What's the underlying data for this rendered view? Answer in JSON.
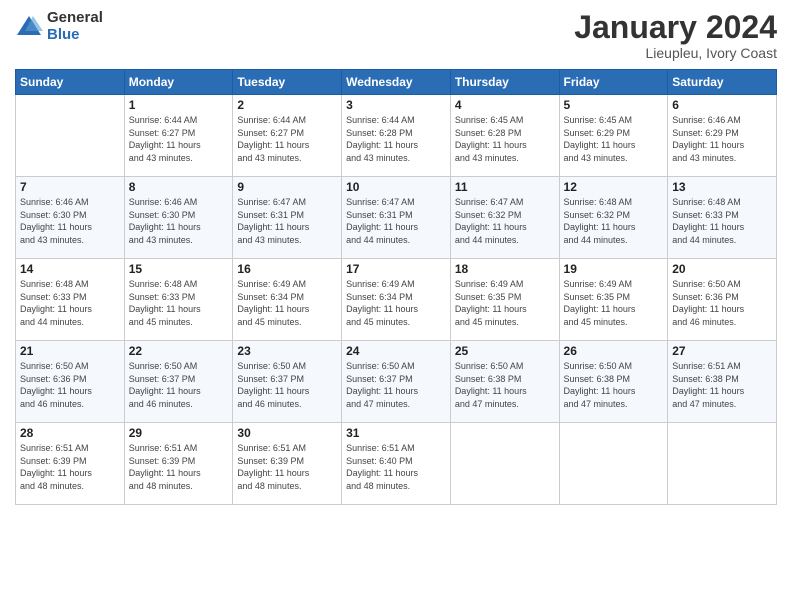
{
  "logo": {
    "general": "General",
    "blue": "Blue"
  },
  "header": {
    "month": "January 2024",
    "location": "Lieupleu, Ivory Coast"
  },
  "days": [
    "Sunday",
    "Monday",
    "Tuesday",
    "Wednesday",
    "Thursday",
    "Friday",
    "Saturday"
  ],
  "weeks": [
    [
      {
        "num": "",
        "info": ""
      },
      {
        "num": "1",
        "info": "Sunrise: 6:44 AM\nSunset: 6:27 PM\nDaylight: 11 hours\nand 43 minutes."
      },
      {
        "num": "2",
        "info": "Sunrise: 6:44 AM\nSunset: 6:27 PM\nDaylight: 11 hours\nand 43 minutes."
      },
      {
        "num": "3",
        "info": "Sunrise: 6:44 AM\nSunset: 6:28 PM\nDaylight: 11 hours\nand 43 minutes."
      },
      {
        "num": "4",
        "info": "Sunrise: 6:45 AM\nSunset: 6:28 PM\nDaylight: 11 hours\nand 43 minutes."
      },
      {
        "num": "5",
        "info": "Sunrise: 6:45 AM\nSunset: 6:29 PM\nDaylight: 11 hours\nand 43 minutes."
      },
      {
        "num": "6",
        "info": "Sunrise: 6:46 AM\nSunset: 6:29 PM\nDaylight: 11 hours\nand 43 minutes."
      }
    ],
    [
      {
        "num": "7",
        "info": "Sunrise: 6:46 AM\nSunset: 6:30 PM\nDaylight: 11 hours\nand 43 minutes."
      },
      {
        "num": "8",
        "info": "Sunrise: 6:46 AM\nSunset: 6:30 PM\nDaylight: 11 hours\nand 43 minutes."
      },
      {
        "num": "9",
        "info": "Sunrise: 6:47 AM\nSunset: 6:31 PM\nDaylight: 11 hours\nand 43 minutes."
      },
      {
        "num": "10",
        "info": "Sunrise: 6:47 AM\nSunset: 6:31 PM\nDaylight: 11 hours\nand 44 minutes."
      },
      {
        "num": "11",
        "info": "Sunrise: 6:47 AM\nSunset: 6:32 PM\nDaylight: 11 hours\nand 44 minutes."
      },
      {
        "num": "12",
        "info": "Sunrise: 6:48 AM\nSunset: 6:32 PM\nDaylight: 11 hours\nand 44 minutes."
      },
      {
        "num": "13",
        "info": "Sunrise: 6:48 AM\nSunset: 6:33 PM\nDaylight: 11 hours\nand 44 minutes."
      }
    ],
    [
      {
        "num": "14",
        "info": "Sunrise: 6:48 AM\nSunset: 6:33 PM\nDaylight: 11 hours\nand 44 minutes."
      },
      {
        "num": "15",
        "info": "Sunrise: 6:48 AM\nSunset: 6:33 PM\nDaylight: 11 hours\nand 45 minutes."
      },
      {
        "num": "16",
        "info": "Sunrise: 6:49 AM\nSunset: 6:34 PM\nDaylight: 11 hours\nand 45 minutes."
      },
      {
        "num": "17",
        "info": "Sunrise: 6:49 AM\nSunset: 6:34 PM\nDaylight: 11 hours\nand 45 minutes."
      },
      {
        "num": "18",
        "info": "Sunrise: 6:49 AM\nSunset: 6:35 PM\nDaylight: 11 hours\nand 45 minutes."
      },
      {
        "num": "19",
        "info": "Sunrise: 6:49 AM\nSunset: 6:35 PM\nDaylight: 11 hours\nand 45 minutes."
      },
      {
        "num": "20",
        "info": "Sunrise: 6:50 AM\nSunset: 6:36 PM\nDaylight: 11 hours\nand 46 minutes."
      }
    ],
    [
      {
        "num": "21",
        "info": "Sunrise: 6:50 AM\nSunset: 6:36 PM\nDaylight: 11 hours\nand 46 minutes."
      },
      {
        "num": "22",
        "info": "Sunrise: 6:50 AM\nSunset: 6:37 PM\nDaylight: 11 hours\nand 46 minutes."
      },
      {
        "num": "23",
        "info": "Sunrise: 6:50 AM\nSunset: 6:37 PM\nDaylight: 11 hours\nand 46 minutes."
      },
      {
        "num": "24",
        "info": "Sunrise: 6:50 AM\nSunset: 6:37 PM\nDaylight: 11 hours\nand 47 minutes."
      },
      {
        "num": "25",
        "info": "Sunrise: 6:50 AM\nSunset: 6:38 PM\nDaylight: 11 hours\nand 47 minutes."
      },
      {
        "num": "26",
        "info": "Sunrise: 6:50 AM\nSunset: 6:38 PM\nDaylight: 11 hours\nand 47 minutes."
      },
      {
        "num": "27",
        "info": "Sunrise: 6:51 AM\nSunset: 6:38 PM\nDaylight: 11 hours\nand 47 minutes."
      }
    ],
    [
      {
        "num": "28",
        "info": "Sunrise: 6:51 AM\nSunset: 6:39 PM\nDaylight: 11 hours\nand 48 minutes."
      },
      {
        "num": "29",
        "info": "Sunrise: 6:51 AM\nSunset: 6:39 PM\nDaylight: 11 hours\nand 48 minutes."
      },
      {
        "num": "30",
        "info": "Sunrise: 6:51 AM\nSunset: 6:39 PM\nDaylight: 11 hours\nand 48 minutes."
      },
      {
        "num": "31",
        "info": "Sunrise: 6:51 AM\nSunset: 6:40 PM\nDaylight: 11 hours\nand 48 minutes."
      },
      {
        "num": "",
        "info": ""
      },
      {
        "num": "",
        "info": ""
      },
      {
        "num": "",
        "info": ""
      }
    ]
  ]
}
